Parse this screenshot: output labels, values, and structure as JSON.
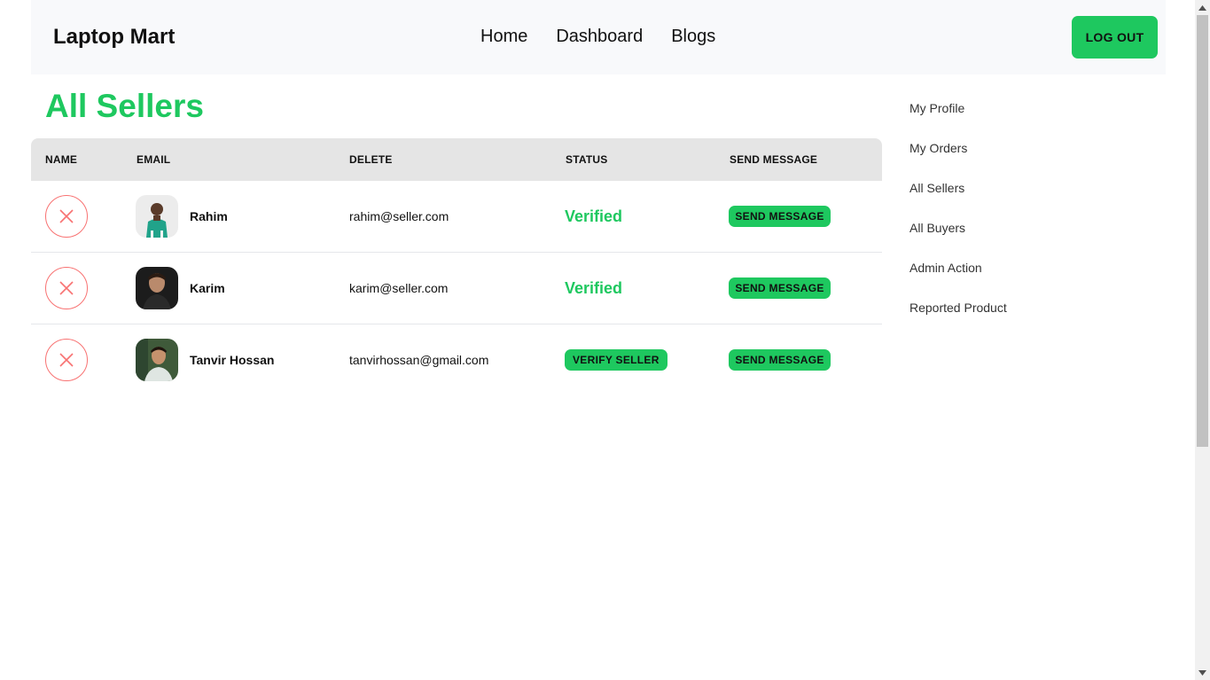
{
  "navbar": {
    "brand": "Laptop Mart",
    "links": [
      "Home",
      "Dashboard",
      "Blogs"
    ],
    "logout_label": "LOG OUT"
  },
  "page_title": "All Sellers",
  "table": {
    "headers": [
      "NAME",
      "EMAIL",
      "DELETE",
      "STATUS",
      "SEND MESSAGE"
    ],
    "rows": [
      {
        "name": "Rahim",
        "email": "rahim@seller.com",
        "status": "Verified",
        "verified": true,
        "message_label": "SEND MESSAGE"
      },
      {
        "name": "Karim",
        "email": "karim@seller.com",
        "status": "Verified",
        "verified": true,
        "message_label": "SEND MESSAGE"
      },
      {
        "name": "Tanvir Hossan",
        "email": "tanvirhossan@gmail.com",
        "status": "VERIFY SELLER",
        "verified": false,
        "message_label": "SEND MESSAGE"
      }
    ]
  },
  "sidebar": {
    "items": [
      "My Profile",
      "My Orders",
      "All Sellers",
      "All Buyers",
      "Admin Action",
      "Reported Product"
    ]
  },
  "colors": {
    "accent": "#1ec85f",
    "delete_red": "#f87272",
    "header_bg": "#e5e5e5",
    "navbar_bg": "#f8f9fb"
  },
  "icons": {
    "delete": "close-icon",
    "scroll_up": "chevron-up-icon",
    "scroll_down": "chevron-down-icon"
  }
}
